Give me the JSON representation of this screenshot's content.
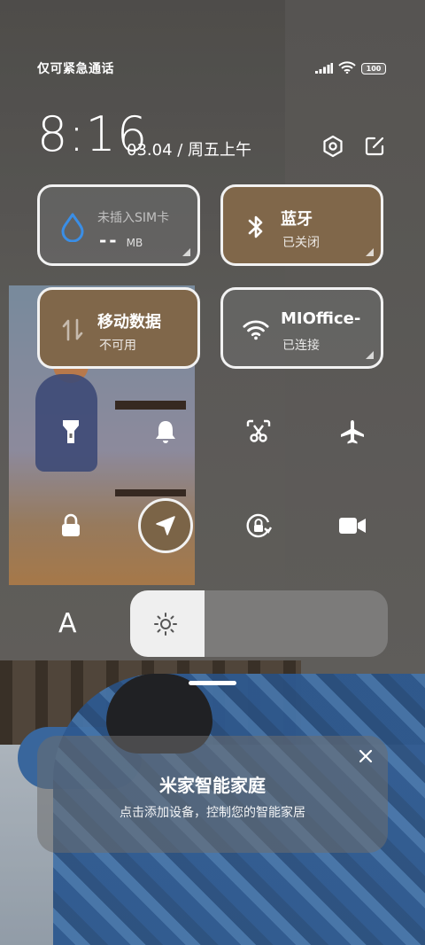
{
  "status_bar": {
    "carrier_text": "仅可紧急通话",
    "battery": "100"
  },
  "header": {
    "time": "8:16",
    "date": "03.04 / 周五上午"
  },
  "tiles": {
    "data": {
      "title": "未插入SIM卡",
      "value": "--",
      "unit": "MB"
    },
    "bluetooth": {
      "title": "蓝牙",
      "subtitle": "已关闭"
    },
    "mobile_data": {
      "title": "移动数据",
      "subtitle": "不可用"
    },
    "wifi": {
      "title": "MIOffice-",
      "subtitle": "已连接"
    }
  },
  "toggles": [
    {
      "icon": "flashlight-icon",
      "on": false
    },
    {
      "icon": "bell-icon",
      "on": false
    },
    {
      "icon": "screenshot-icon",
      "on": false
    },
    {
      "icon": "airplane-icon",
      "on": false
    },
    {
      "icon": "lock-icon",
      "on": false
    },
    {
      "icon": "location-icon",
      "on": true
    },
    {
      "icon": "rotation-lock-icon",
      "on": false
    },
    {
      "icon": "video-camera-icon",
      "on": false
    }
  ],
  "brightness": {
    "font_label": "A",
    "level": 0.29
  },
  "home_card": {
    "title": "米家智能家庭",
    "subtitle": "点击添加设备，控制您的智能家居"
  },
  "colors": {
    "active_tile": "#80674a",
    "inactive_tile": "#6e6e6e",
    "wifi_blue_drop": "#3a8ee6"
  }
}
